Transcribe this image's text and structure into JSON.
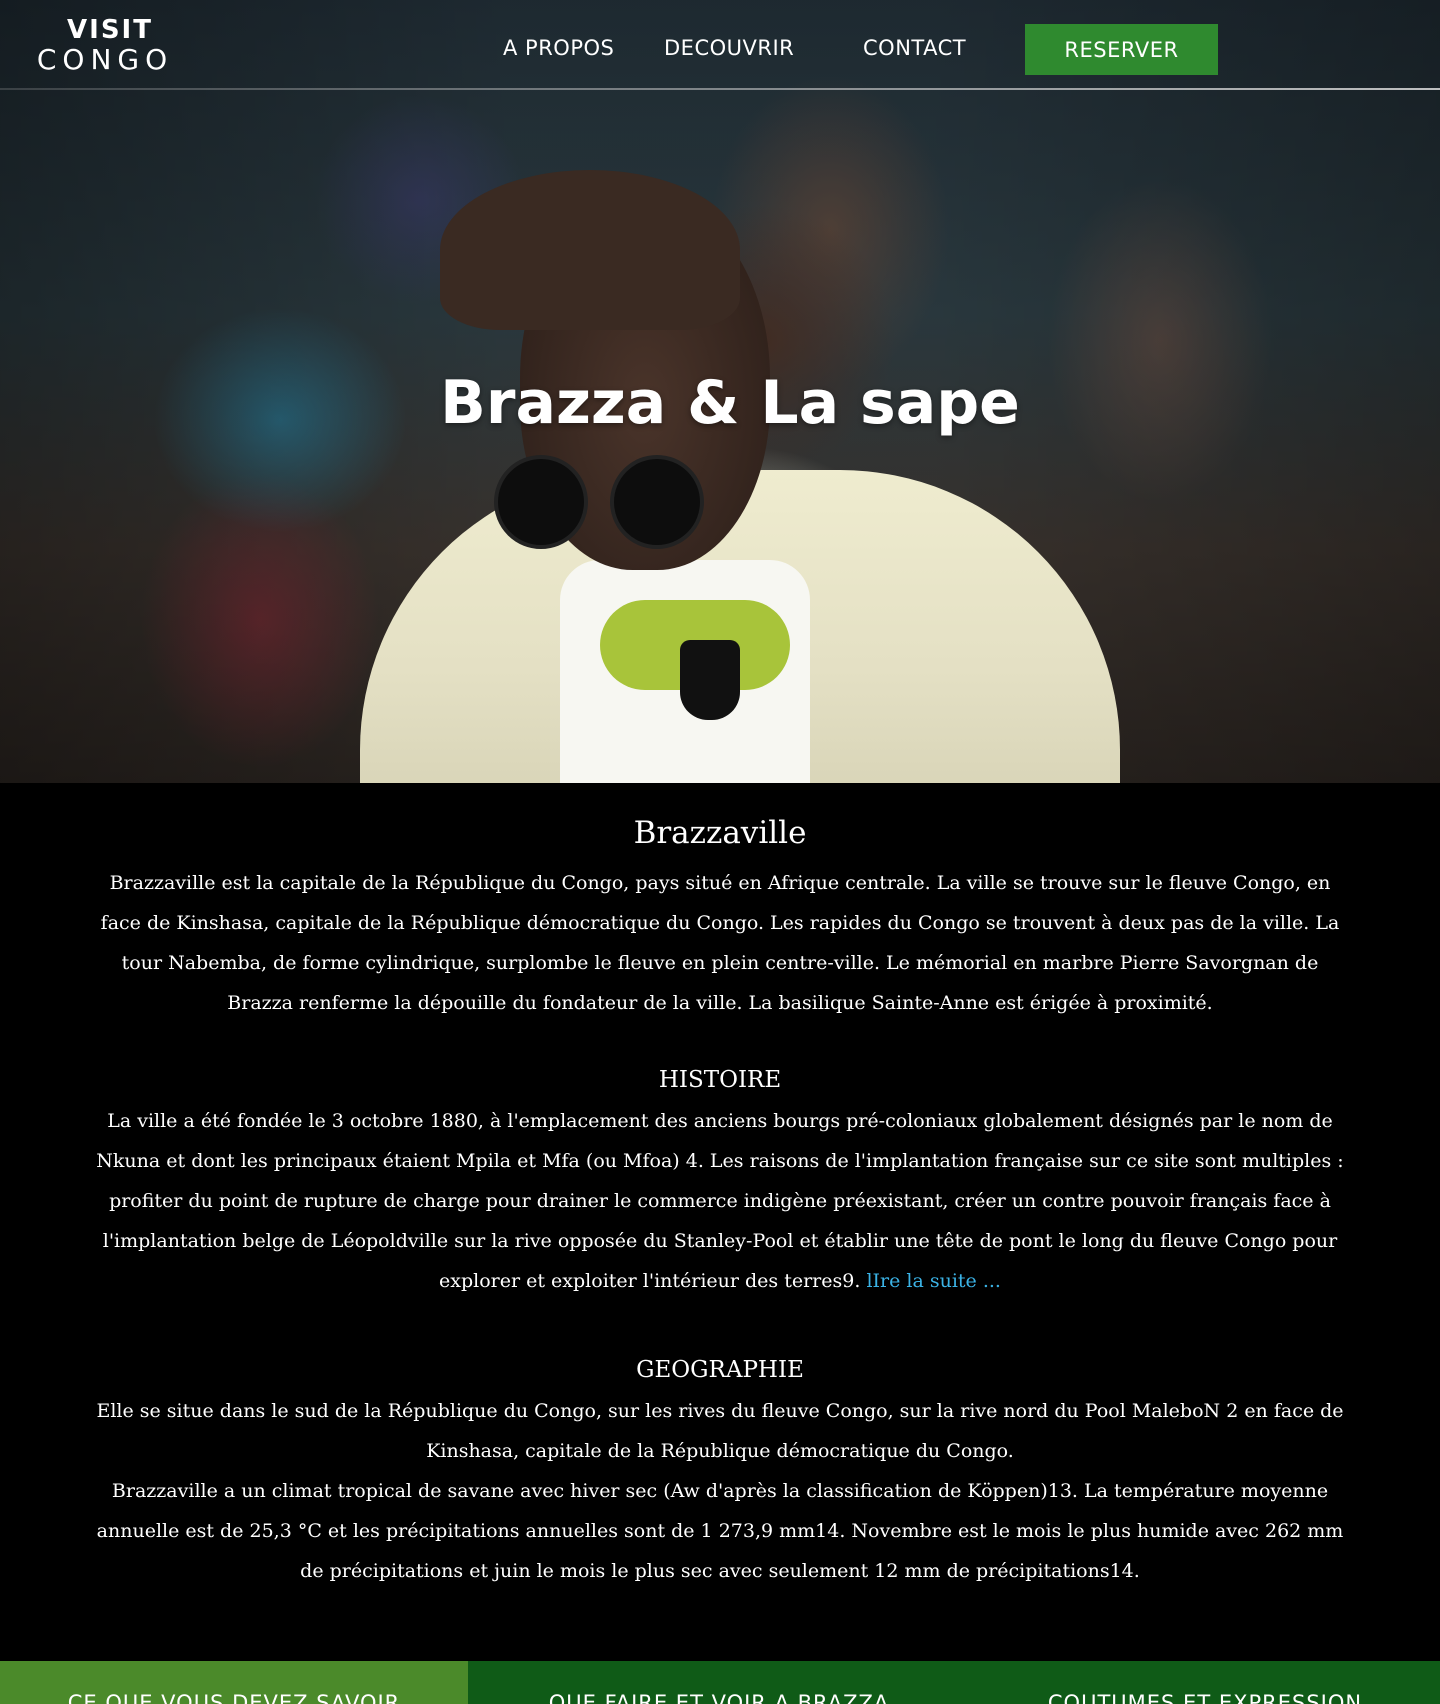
{
  "nav": {
    "logo_line1": "VISIT",
    "logo_line2": "CONGO",
    "links": [
      "A PROPOS",
      "DECOUVRIR",
      "CONTACT"
    ],
    "cta_label": "RESERVER"
  },
  "hero": {
    "title": "Brazza & La sape"
  },
  "intro": {
    "heading": "Brazzaville",
    "text": "Brazzaville est la capitale de la République du Congo, pays situé en Afrique centrale. La ville se trouve sur le fleuve Congo, en face de Kinshasa, capitale de la République démocratique du Congo. Les rapides du Congo se trouvent à deux pas de la ville. La tour Nabemba, de forme cylindrique, surplombe le fleuve en plein centre-ville. Le mémorial en marbre Pierre Savorgnan de Brazza renferme la dépouille du fondateur de la ville. La basilique Sainte-Anne est érigée à proximité."
  },
  "histoire": {
    "heading": "HISTOIRE",
    "text": "La ville a été fondée le 3 octobre 1880, à l'emplacement des anciens bourgs pré-coloniaux globalement désignés par le nom de Nkuna et dont les principaux étaient Mpila et Mfa (ou Mfoa) 4. Les raisons de l'implantation française sur ce site sont multiples : profiter du point de rupture de charge pour drainer le commerce indigène préexistant, créer un contre pouvoir français face à l'implantation belge de Léopoldville sur la rive opposée du Stanley-Pool et établir une tête de pont le long du fleuve Congo pour explorer et exploiter l'intérieur des terres9.",
    "link": "lIre la suite ..."
  },
  "geographie": {
    "heading": "GEOGRAPHIE",
    "text1": "Elle se situe dans le sud de la République du Congo, sur les rives du fleuve Congo, sur la rive nord du Pool MaleboN 2 en face de Kinshasa, capitale de la République démocratique du Congo.",
    "text2": "Brazzaville a un climat tropical de savane avec hiver sec (Aw d'après la classification de Köppen)13. La température moyenne annuelle est de 25,3 °C et les précipitations annuelles sont de 1 273,9 mm14. Novembre est le mois le plus humide avec 262 mm de précipitations et juin le mois le plus sec avec seulement 12 mm de précipitations14."
  },
  "tabs": [
    "CE QUE VOUS DEVEZ SAVOIR",
    "QUE FAIRE ET VOIR A BRAZZA",
    "COUTUMES ET EXPRESSION"
  ],
  "colors": {
    "cta_green": "#2f8a2f",
    "link_blue": "#3bb3e6",
    "tab_light_green": "#4b8a2a",
    "tab_dark_green": "#0f5b17"
  }
}
